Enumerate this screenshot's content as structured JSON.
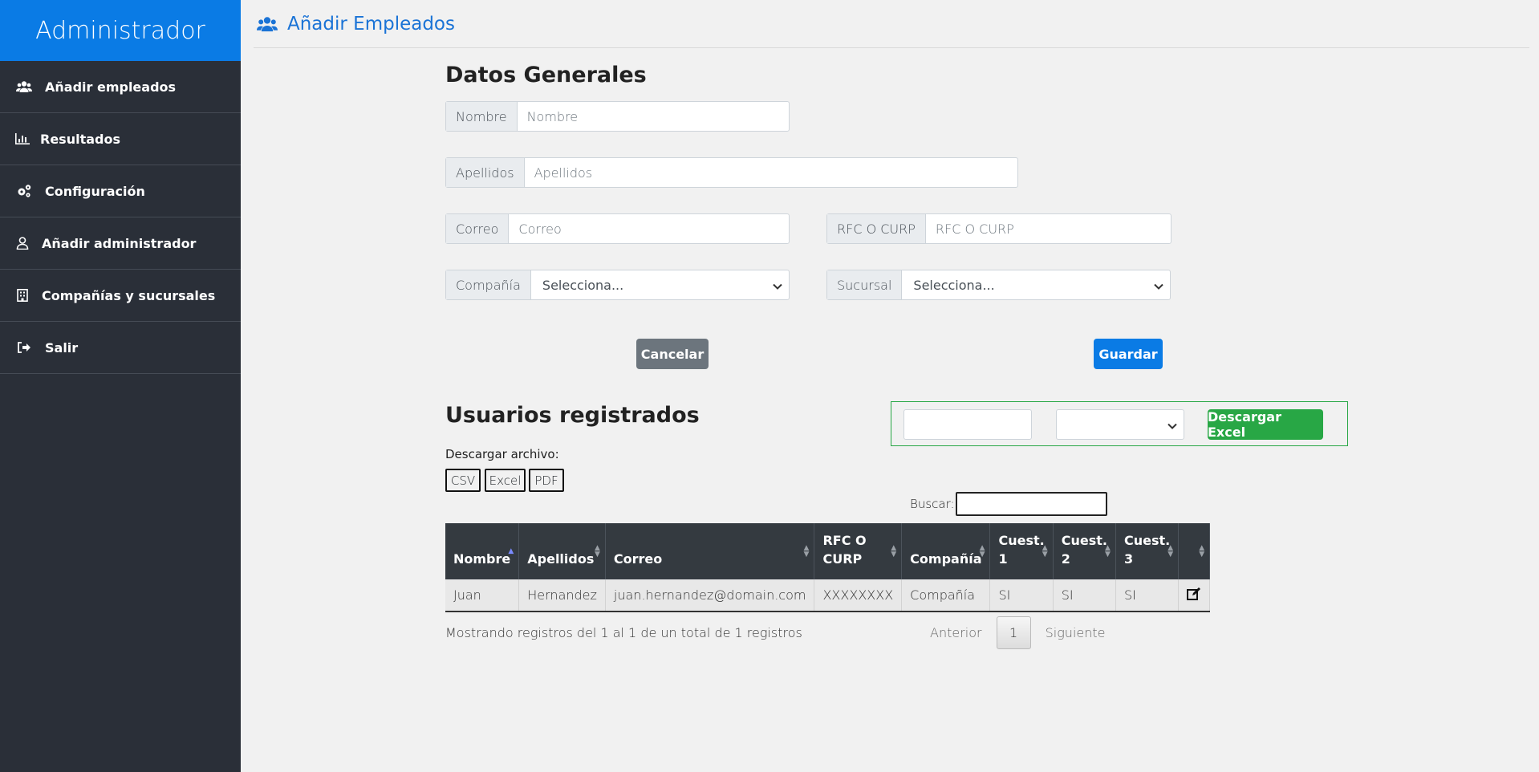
{
  "sidebar": {
    "title": "Administrador",
    "items": [
      {
        "label": "Añadir empleados",
        "icon": "users-icon"
      },
      {
        "label": "Resultados",
        "icon": "bar-chart-icon"
      },
      {
        "label": "Configuración",
        "icon": "cogs-icon"
      },
      {
        "label": "Añadir administrador",
        "icon": "user-icon"
      },
      {
        "label": "Compañías y sucursales",
        "icon": "building-icon"
      },
      {
        "label": "Salir",
        "icon": "sign-out-icon"
      }
    ]
  },
  "header": {
    "title": "Añadir Empleados",
    "icon": "users-icon"
  },
  "form": {
    "heading": "Datos Generales",
    "nombre": {
      "label": "Nombre",
      "placeholder": "Nombre"
    },
    "apellidos": {
      "label": "Apellidos",
      "placeholder": "Apellidos"
    },
    "correo": {
      "label": "Correo",
      "placeholder": "Correo"
    },
    "rfc": {
      "label": "RFC O CURP",
      "placeholder": "RFC O CURP"
    },
    "compania": {
      "label": "Compañía",
      "value": "Selecciona..."
    },
    "sucursal": {
      "label": "Sucursal",
      "value": "Selecciona..."
    },
    "cancel_label": "Cancelar",
    "save_label": "Guardar"
  },
  "users": {
    "heading": "Usuarios registrados",
    "download_label": "Descargar archivo:",
    "download_buttons": [
      "CSV",
      "Excel",
      "PDF"
    ],
    "excel_button": "Descargar Excel",
    "search_label": "Buscar:",
    "columns": [
      "Nombre",
      "Apellidos",
      "Correo",
      "RFC O CURP",
      "Compañía",
      "Cuest. 1",
      "Cuest. 2",
      "Cuest. 3",
      ""
    ],
    "rows": [
      [
        "Juan",
        "Hernandez",
        "juan.hernandez@domain.com",
        "XXXXXXXX",
        "Compañía",
        "SI",
        "SI",
        "SI"
      ]
    ],
    "info": "Mostrando registros del 1 al 1 de un total de 1 registros",
    "pager": {
      "prev": "Anterior",
      "current": "1",
      "next": "Siguiente"
    }
  },
  "colors": {
    "accent": "#0a7be5",
    "sidebar": "#2a2f38",
    "save": "#0a7be5",
    "cancel": "#6c757d",
    "excel": "#28a745",
    "table_header": "#343a40"
  }
}
